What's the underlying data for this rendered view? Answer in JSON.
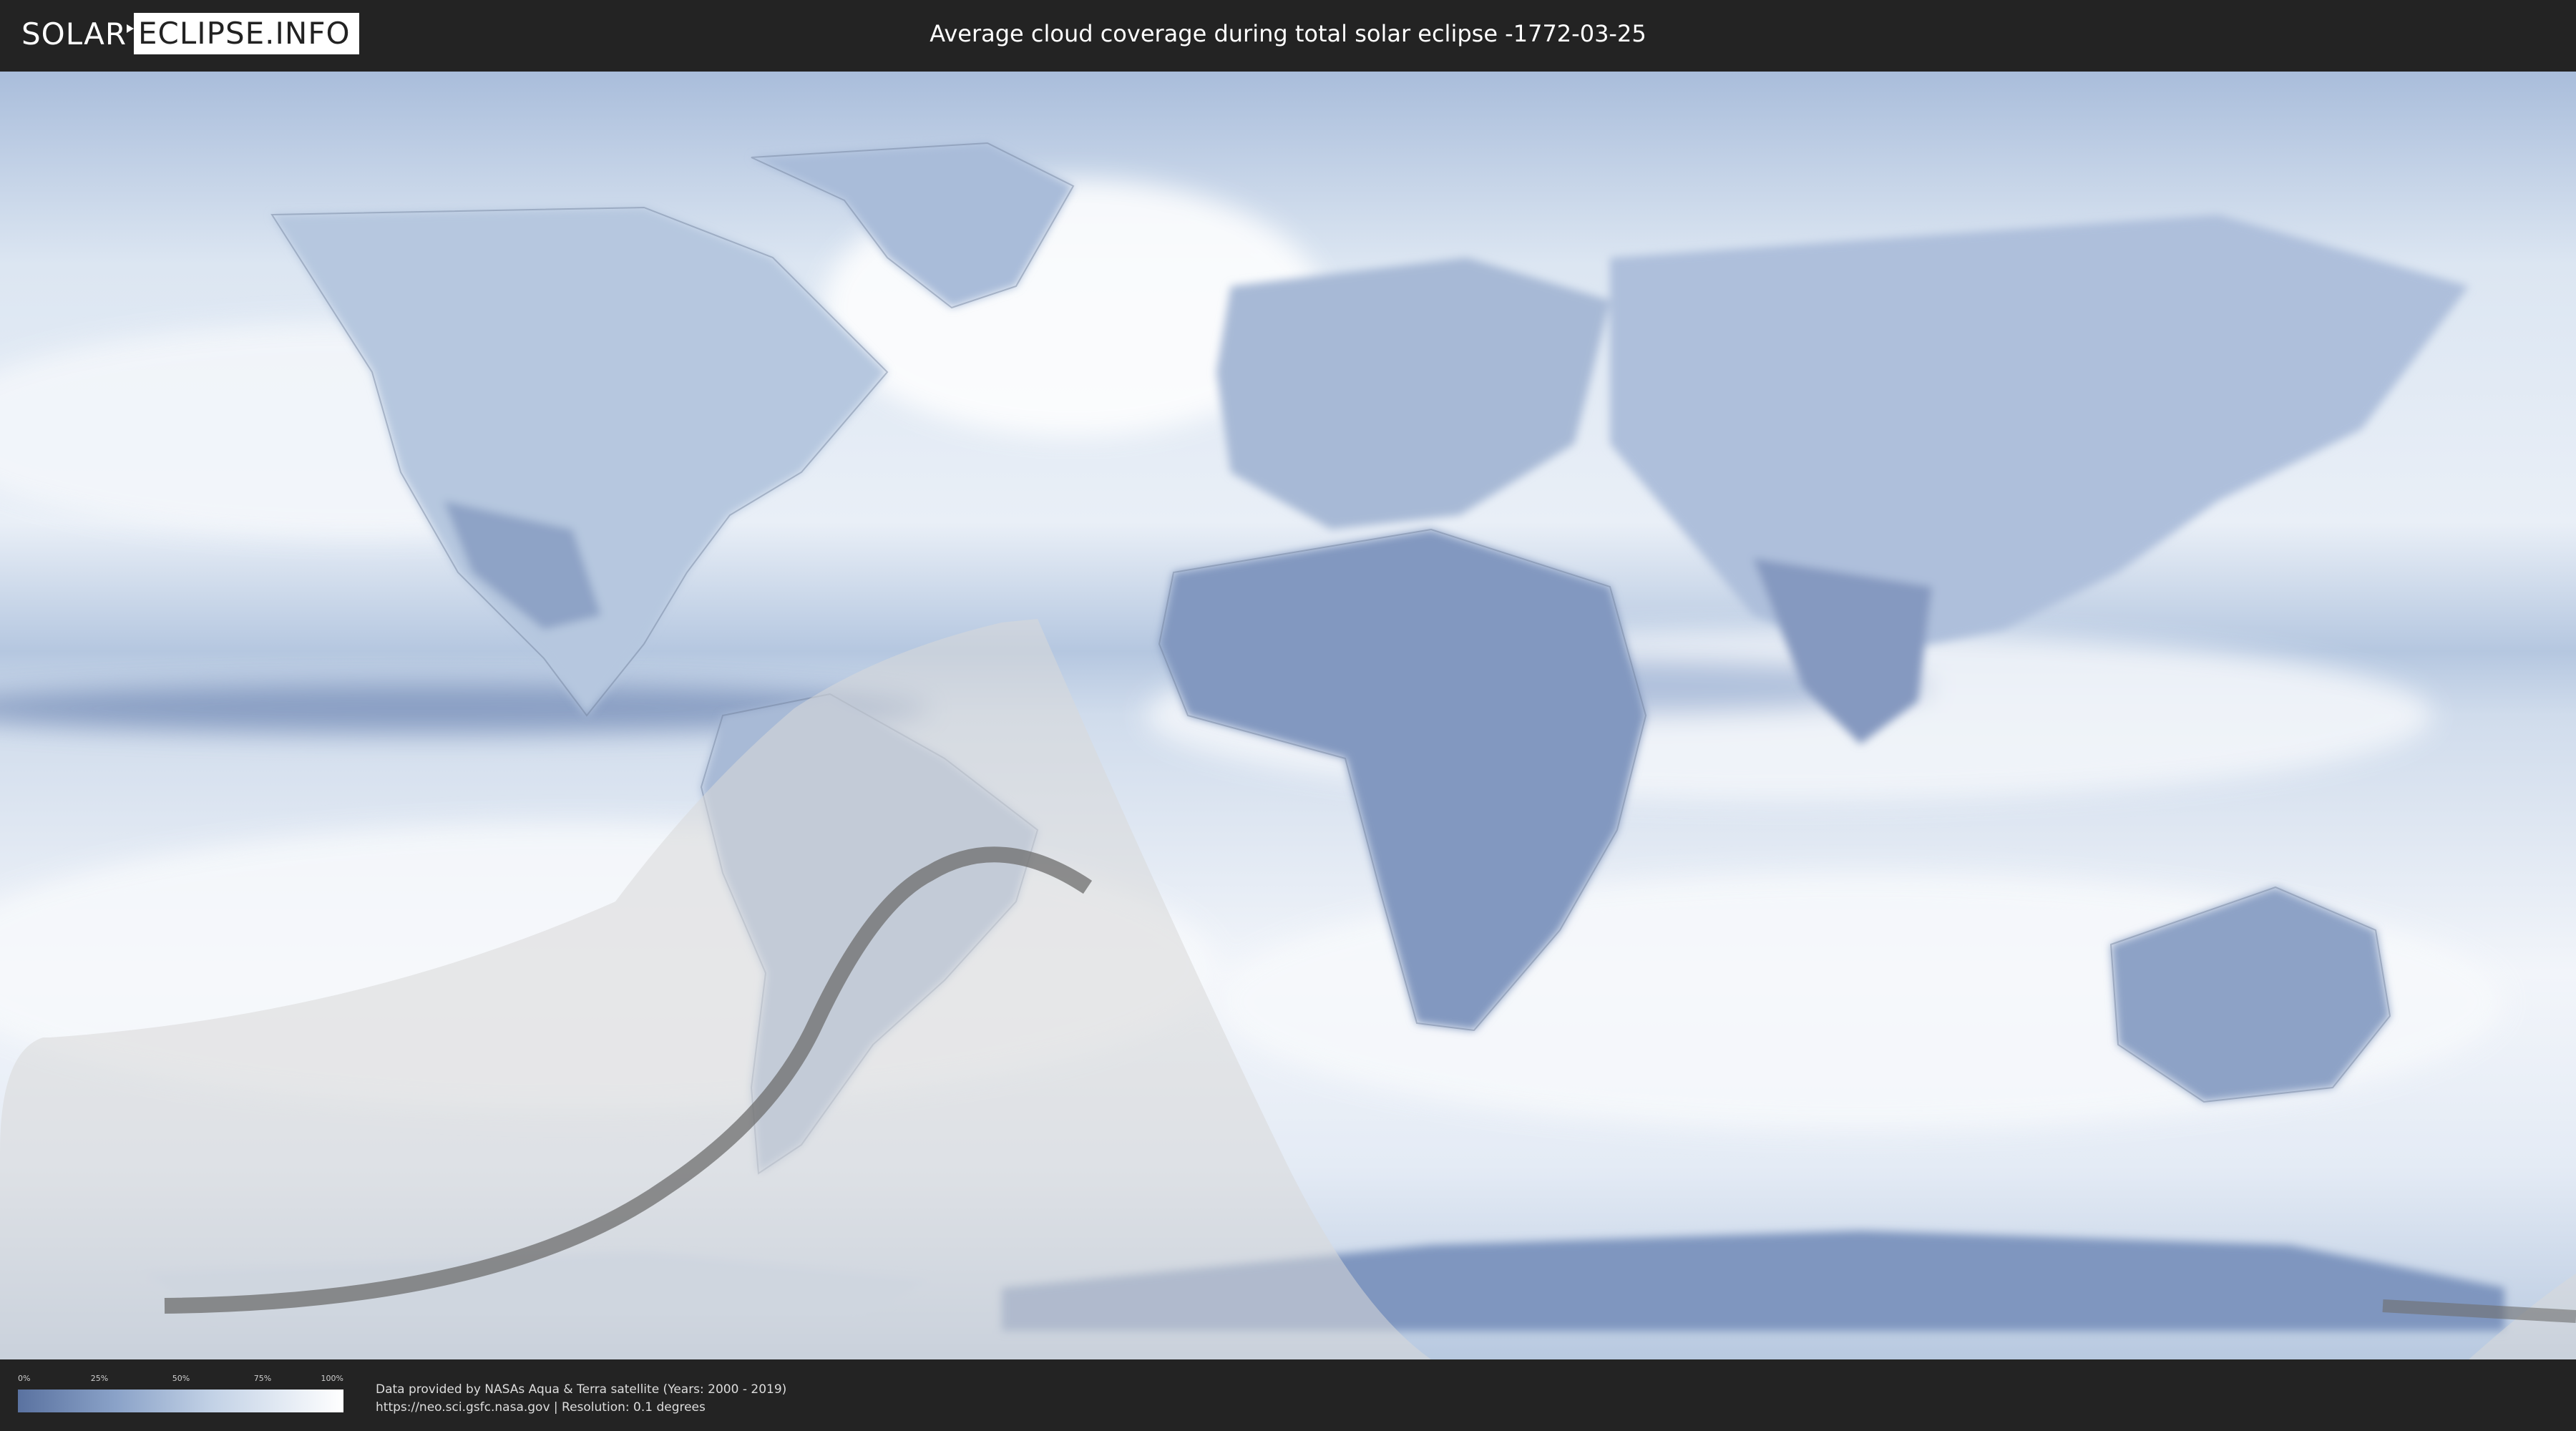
{
  "logo": {
    "part1": "SOLAR",
    "part2": "ECLIPSE.INFO"
  },
  "header": {
    "title": "Average cloud coverage during total solar eclipse -1772-03-25"
  },
  "legend": {
    "ticks": [
      "0%",
      "25%",
      "50%",
      "75%",
      "100%"
    ],
    "gradient_colors": [
      "#5a72a0",
      "#8aa2c8",
      "#c3d2e6",
      "#ffffff"
    ]
  },
  "attribution": {
    "line1": "Data provided by NASAs Aqua & Terra satellite (Years: 2000 - 2019)",
    "line2": "https://neo.sci.gsfc.nasa.gov | Resolution: 0.1 degrees"
  },
  "colors": {
    "background": "#232323",
    "ocean_cloud": "#c9d8ec",
    "land_clear": "#7d92b8",
    "eclipse_shadow": "#d9d9d9",
    "central_path": "#6e6e6e"
  }
}
